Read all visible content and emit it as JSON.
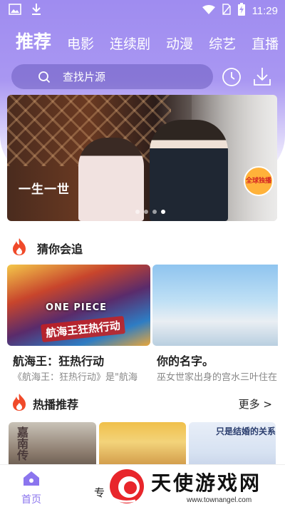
{
  "status_bar": {
    "time": "11:29"
  },
  "tabs": [
    {
      "label": "推荐",
      "active": true
    },
    {
      "label": "电影",
      "active": false
    },
    {
      "label": "连续剧",
      "active": false
    },
    {
      "label": "动漫",
      "active": false
    },
    {
      "label": "综艺",
      "active": false
    },
    {
      "label": "直播",
      "active": false
    }
  ],
  "search": {
    "placeholder": "查找片源",
    "icon": "search-icon"
  },
  "header_actions": {
    "history_icon": "clock-icon",
    "download_icon": "download-icon"
  },
  "banner": {
    "calligraphy": "一生一世",
    "badge_text": "全球独播",
    "slide_count": 4,
    "active_slide": 4
  },
  "guess_section": {
    "title": "猜你会追",
    "icon": "flame-icon",
    "items": [
      {
        "title": "航海王：狂热行动",
        "desc": "《航海王：狂热行动》是\"航海",
        "poster_text": "ONE PIECE",
        "poster_logo": "航海王狂热行动"
      },
      {
        "title": "你的名字。",
        "desc": "巫女世家出身的宫水三叶住在"
      }
    ]
  },
  "hot_section": {
    "title": "热播推荐",
    "icon": "flame-icon",
    "more_label": "更多 >",
    "items": [
      {
        "poster_text": "嘉南传"
      },
      {
        "poster_text": ""
      },
      {
        "poster_text": "只是结婚的关系"
      }
    ]
  },
  "bottom_nav": {
    "home_label": "首页",
    "topic_label": "专"
  },
  "watermark": {
    "text": "天使游戏网",
    "url": "www.townangel.com"
  },
  "colors": {
    "accent": "#8b75ee",
    "header_top": "#9f8cf0",
    "flame": "#f04a2a"
  }
}
